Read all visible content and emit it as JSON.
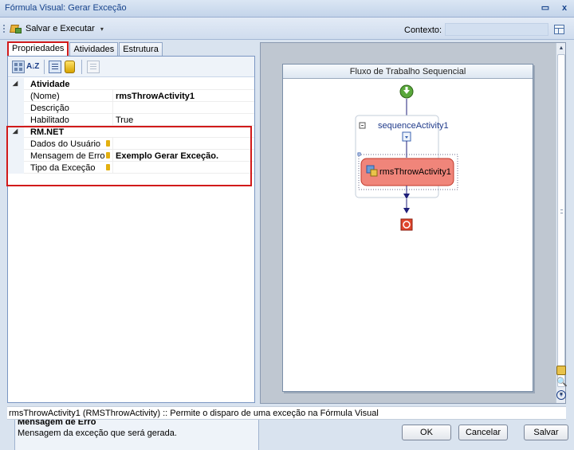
{
  "window": {
    "title": "Fórmula Visual: Gerar Exceção",
    "restore_glyph": "▭",
    "close_glyph": "x"
  },
  "toolbar": {
    "save_execute_label": "Salvar e Executar",
    "save_execute_caret": "▾",
    "context_label": "Contexto:",
    "context_value": ""
  },
  "tabs": [
    {
      "label": "Propriedades",
      "active": true
    },
    {
      "label": "Atividades",
      "active": false
    },
    {
      "label": "Estrutura",
      "active": false
    }
  ],
  "property_toolbar": {
    "az_glyph": "A↓Z"
  },
  "property_grid": {
    "expand_glyph": "◢",
    "categories": [
      {
        "name": "Atividade",
        "rows": [
          {
            "name": "(Nome)",
            "value": "rmsThrowActivity1",
            "bold": true,
            "lock": false
          },
          {
            "name": "Descrição",
            "value": "",
            "bold": false,
            "lock": false
          },
          {
            "name": "Habilitado",
            "value": "True",
            "bold": false,
            "lock": false
          }
        ]
      },
      {
        "name": "RM.NET",
        "rows": [
          {
            "name": "Dados do Usuário",
            "value": "",
            "bold": false,
            "lock": true
          },
          {
            "name": "Mensagem de Erro",
            "value": "Exemplo Gerar Exceção.",
            "bold": true,
            "lock": true
          },
          {
            "name": "Tipo da Exceção",
            "value": "",
            "bold": false,
            "lock": true
          }
        ]
      }
    ]
  },
  "help": {
    "title": "Mensagem de Erro",
    "description": "Mensagem da exceção que será gerada."
  },
  "designer": {
    "workflow_title": "Fluxo de Trabalho Sequencial",
    "sequence_label": "sequenceActivity1",
    "sequence_toggle": "⊟",
    "throw_activity_label": "rmsThrowActivity1",
    "colors": {
      "activity_fill": "#f0857a",
      "activity_border": "#c0392b",
      "start_green": "#5aa83c",
      "end_red": "#e0452c",
      "connector": "#1f1f7a"
    }
  },
  "scrollbar": {
    "up_glyph": "▲",
    "down_glyph": "▼"
  },
  "side_icons": {
    "find_glyph": "🔍",
    "zoom_glyph": "+"
  },
  "status": {
    "text": "rmsThrowActivity1  (RMSThrowActivity)  :: Permite o disparo de uma exceção na Fórmula Visual"
  },
  "buttons": {
    "ok": "OK",
    "cancel": "Cancelar",
    "save": "Salvar"
  }
}
